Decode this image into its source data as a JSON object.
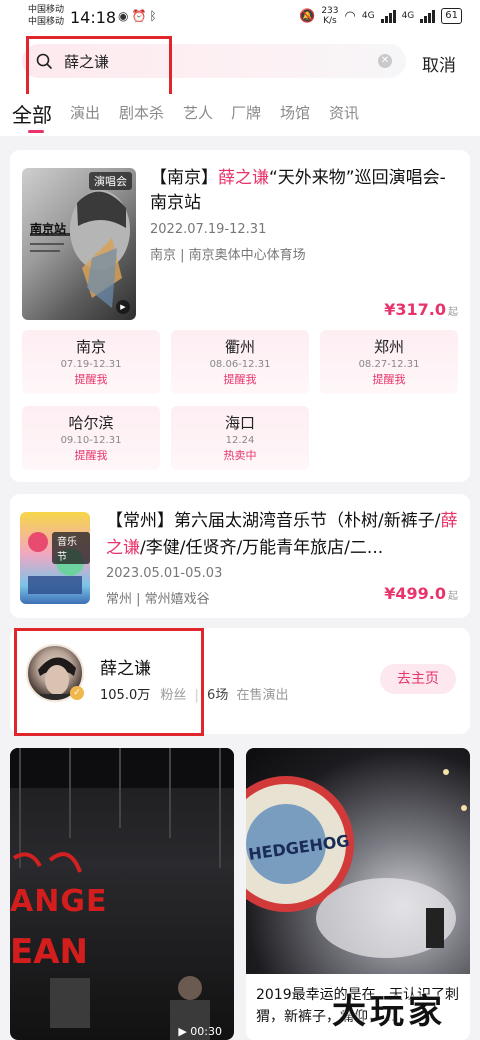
{
  "status_bar": {
    "carrier1": "中国移动",
    "carrier2": "中国移动",
    "time": "14:18",
    "net_speed": "233",
    "net_unit": "K/s",
    "net_type": "4G",
    "net_type2": "4G",
    "battery": "61"
  },
  "search": {
    "query": "薛之谦",
    "cancel_label": "取消"
  },
  "tabs": [
    {
      "label": "全部",
      "active": true
    },
    {
      "label": "演出"
    },
    {
      "label": "剧本杀"
    },
    {
      "label": "艺人"
    },
    {
      "label": "厂牌"
    },
    {
      "label": "场馆"
    },
    {
      "label": "资讯"
    }
  ],
  "event1": {
    "tag": "演唱会",
    "title_pre": "【南京】",
    "title_hl": "薛之谦",
    "title_post": "“天外来物”巡回演唱会-南京站",
    "date": "2022.07.19-12.31",
    "venue": "南京 | 南京奥体中心体育场",
    "price": "¥317.0",
    "price_suffix": "起",
    "poster_text1": "南京站",
    "cities": [
      {
        "name": "南京",
        "date": "07.19-12.31",
        "status": "提醒我"
      },
      {
        "name": "衢州",
        "date": "08.06-12.31",
        "status": "提醒我"
      },
      {
        "name": "郑州",
        "date": "08.27-12.31",
        "status": "提醒我"
      },
      {
        "name": "哈尔滨",
        "date": "09.10-12.31",
        "status": "提醒我"
      },
      {
        "name": "海口",
        "date": "12.24",
        "status": "热卖中"
      }
    ]
  },
  "event2": {
    "tag": "音乐节",
    "title_pre": "【常州】第六届太湖湾音乐节（朴树/新裤子/",
    "title_hl": "薛之谦",
    "title_post": "/李健/任贤齐/万能青年旅店/二...",
    "date": "2023.05.01-05.03",
    "venue": "常州 | 常州嬉戏谷",
    "price": "¥499.0",
    "price_suffix": "起"
  },
  "artist": {
    "name": "薛之谦",
    "fans_count": "105.0万",
    "fans_label": "粉丝",
    "shows_count": "6场",
    "shows_label": "在售演出",
    "home_label": "去主页"
  },
  "videos": [
    {
      "duration": "00:30",
      "text1": "ANGE",
      "text2": "EAN"
    },
    {
      "caption": "2019最幸运的是在...天认识了刺猬，新裤子，痛仰，...",
      "logo_text": "HEDGEHOG"
    }
  ],
  "watermark": "大玩家",
  "colors": {
    "accent": "#e8346a",
    "annotation": "#e0262d"
  }
}
